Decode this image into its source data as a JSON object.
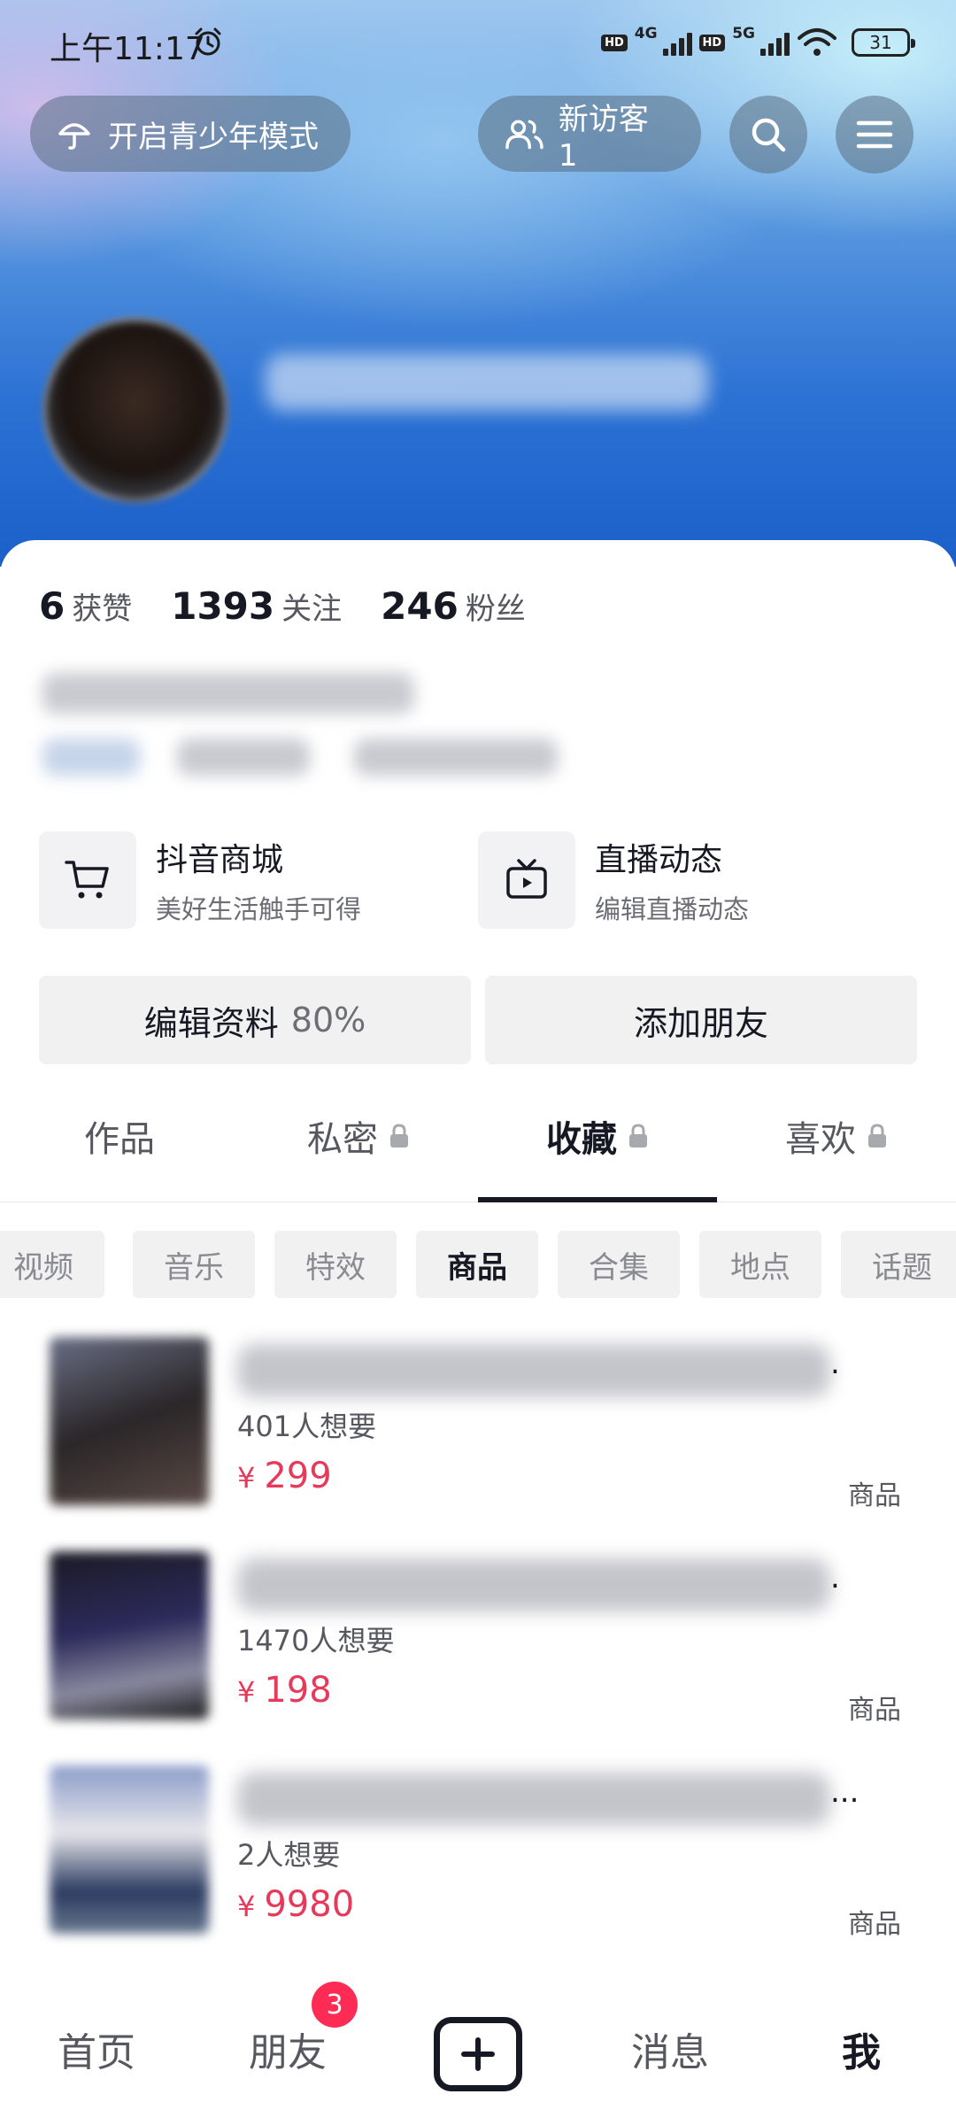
{
  "status_bar": {
    "time": "上午11:17",
    "alarm_icon": "alarm-clock-icon",
    "hd1": "HD",
    "net1": "4G",
    "hd2": "HD",
    "net2": "5G",
    "battery": "31"
  },
  "header": {
    "teen_mode_label": "开启青少年模式",
    "visitor_label": "新访客 1",
    "search_icon": "search-icon",
    "menu_icon": "menu-icon"
  },
  "stats": [
    {
      "value": "6",
      "label": "获赞"
    },
    {
      "value": "1393",
      "label": "关注"
    },
    {
      "value": "246",
      "label": "粉丝"
    }
  ],
  "features": [
    {
      "title": "抖音商城",
      "subtitle": "美好生活触手可得",
      "icon": "shopping-cart-icon"
    },
    {
      "title": "直播动态",
      "subtitle": "编辑直播动态",
      "icon": "tv-icon"
    }
  ],
  "actions": {
    "edit_profile": "编辑资料",
    "edit_profile_progress": "80%",
    "add_friend": "添加朋友"
  },
  "tabs": [
    {
      "label": "作品",
      "locked": false
    },
    {
      "label": "私密",
      "locked": true
    },
    {
      "label": "收藏",
      "locked": true,
      "active": true
    },
    {
      "label": "喜欢",
      "locked": true
    }
  ],
  "chips": [
    "视频",
    "音乐",
    "特效",
    "商品",
    "合集",
    "地点",
    "话题"
  ],
  "active_chip": "商品",
  "products": [
    {
      "ellipsis": ".",
      "want": "401人想要",
      "currency": "¥",
      "price": "299",
      "tag": "商品"
    },
    {
      "ellipsis": ".",
      "want": "1470人想要",
      "currency": "¥",
      "price": "198",
      "tag": "商品"
    },
    {
      "ellipsis": "...",
      "want": "2人想要",
      "currency": "¥",
      "price": "9980",
      "tag": "商品"
    }
  ],
  "bottom_nav": {
    "home": "首页",
    "friends": "朋友",
    "friends_badge": "3",
    "messages": "消息",
    "me": "我"
  },
  "colors": {
    "accent": "#fe2c55",
    "price": "#e63a5a",
    "text_primary": "#161823"
  }
}
